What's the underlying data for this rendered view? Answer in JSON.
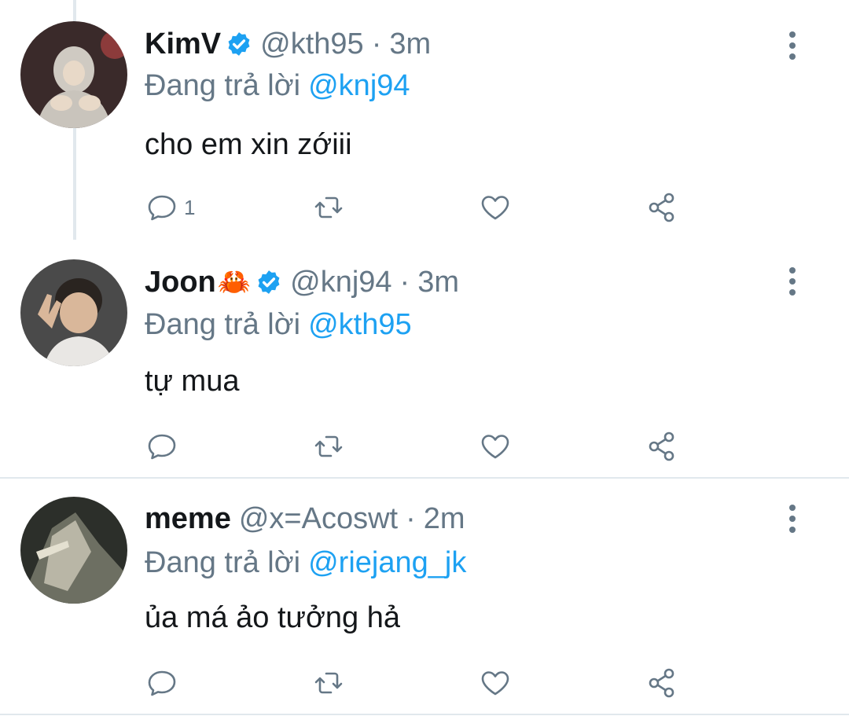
{
  "reply_prefix": "Đang trả lời",
  "tweets": [
    {
      "name": "KimV",
      "emoji": "",
      "verified": true,
      "handle": "@kth95",
      "separator": "·",
      "time": "3m",
      "reply_to": "@knj94",
      "text": "cho em xin zớiii",
      "reply_count": "1"
    },
    {
      "name": "Joon",
      "emoji": "🦀",
      "verified": true,
      "handle": "@knj94",
      "separator": "·",
      "time": "3m",
      "reply_to": "@kth95",
      "text": "tự mua",
      "reply_count": ""
    },
    {
      "name": "meme",
      "emoji": "",
      "verified": false,
      "handle": "@x=Acoswt",
      "separator": "·",
      "time": "2m",
      "reply_to": "@riejang_jk",
      "text": "ủa má ảo tưởng hả",
      "reply_count": ""
    }
  ],
  "colors": {
    "accent": "#1da1f2",
    "text": "#14171a",
    "muted": "#657786",
    "divider": "#e1e8ed"
  },
  "icons": [
    "reply-icon",
    "retweet-icon",
    "like-icon",
    "share-icon",
    "more-options-icon",
    "verified-badge-icon"
  ]
}
